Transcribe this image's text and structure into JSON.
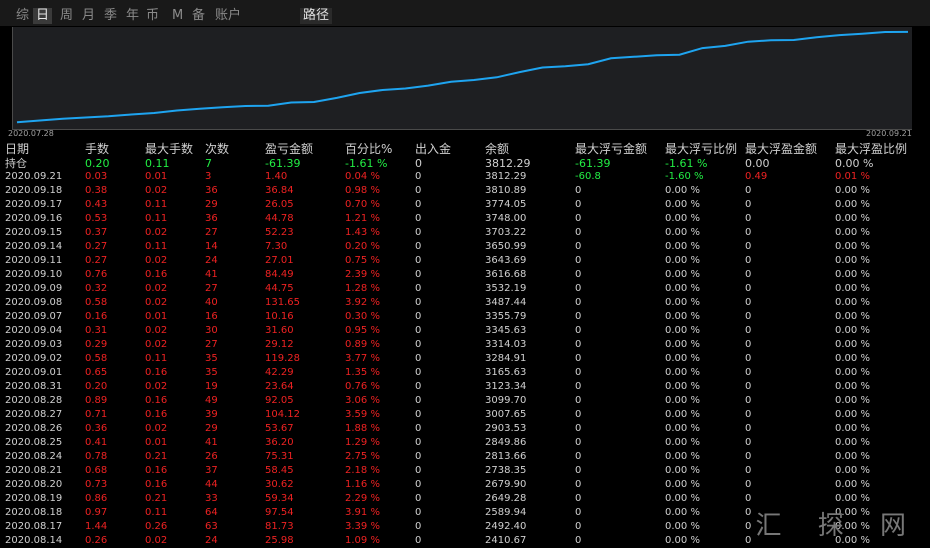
{
  "toolbar": {
    "tabs": [
      "综",
      "日",
      "周",
      "月",
      "季",
      "年",
      "币",
      "M",
      "备",
      "账户"
    ],
    "active_index": 1,
    "route_label": "路径"
  },
  "chart_data": {
    "type": "line",
    "x": [
      "2020.07.28",
      "2020.07.29",
      "2020.07.30",
      "2020.07.31",
      "2020.08.03",
      "2020.08.04",
      "2020.08.05",
      "2020.08.06",
      "2020.08.07",
      "2020.08.10",
      "2020.08.11",
      "2020.08.12",
      "2020.08.13",
      "2020.08.14",
      "2020.08.17",
      "2020.08.18",
      "2020.08.19",
      "2020.08.20",
      "2020.08.21",
      "2020.08.24",
      "2020.08.25",
      "2020.08.26",
      "2020.08.27",
      "2020.08.28",
      "2020.08.31",
      "2020.09.01",
      "2020.09.02",
      "2020.09.03",
      "2020.09.04",
      "2020.09.07",
      "2020.09.08",
      "2020.09.09",
      "2020.09.10",
      "2020.09.11",
      "2020.09.14",
      "2020.09.15",
      "2020.09.16",
      "2020.09.17",
      "2020.09.18",
      "2020.09.21"
    ],
    "values": [
      2005,
      2040,
      2075,
      2100,
      2125,
      2160,
      2190,
      2240,
      2275,
      2305,
      2330,
      2335,
      2400,
      2410.67,
      2492.4,
      2589.94,
      2649.28,
      2679.9,
      2738.35,
      2813.66,
      2849.86,
      2903.53,
      3007.65,
      3099.7,
      3123.34,
      3165.63,
      3284.91,
      3314.03,
      3345.63,
      3355.79,
      3487.44,
      3532.19,
      3616.68,
      3643.69,
      3650.99,
      3703.22,
      3748.0,
      3774.05,
      3810.89,
      3812.29
    ],
    "color": "#1ea4f0",
    "x_start_label": "2020.07.28",
    "x_end_label": "2020.09.21",
    "ylim": [
      1950,
      3830
    ]
  },
  "table": {
    "headers": [
      "日期",
      "手数",
      "最大手数",
      "次数",
      "盈亏金额",
      "百分比%",
      "出入金",
      "余额",
      "最大浮亏金额",
      "最大浮亏比例",
      "最大浮盈金额",
      "最大浮盈比例"
    ],
    "summary": [
      "持仓",
      "0.20",
      "0.11",
      "7",
      "-61.39",
      "-1.61 %",
      "0",
      "3812.29",
      "-61.39",
      "-1.61 %",
      "0.00",
      "0.00 %"
    ],
    "rows": [
      [
        "2020.09.21",
        "0.03",
        "0.01",
        "3",
        "1.40",
        "0.04 %",
        "0",
        "3812.29",
        "-60.8",
        "-1.60 %",
        "0.49",
        "0.01 %"
      ],
      [
        "2020.09.18",
        "0.38",
        "0.02",
        "36",
        "36.84",
        "0.98 %",
        "0",
        "3810.89",
        "0",
        "0.00 %",
        "0",
        "0.00 %"
      ],
      [
        "2020.09.17",
        "0.43",
        "0.11",
        "29",
        "26.05",
        "0.70 %",
        "0",
        "3774.05",
        "0",
        "0.00 %",
        "0",
        "0.00 %"
      ],
      [
        "2020.09.16",
        "0.53",
        "0.11",
        "36",
        "44.78",
        "1.21 %",
        "0",
        "3748.00",
        "0",
        "0.00 %",
        "0",
        "0.00 %"
      ],
      [
        "2020.09.15",
        "0.37",
        "0.02",
        "27",
        "52.23",
        "1.43 %",
        "0",
        "3703.22",
        "0",
        "0.00 %",
        "0",
        "0.00 %"
      ],
      [
        "2020.09.14",
        "0.27",
        "0.11",
        "14",
        "7.30",
        "0.20 %",
        "0",
        "3650.99",
        "0",
        "0.00 %",
        "0",
        "0.00 %"
      ],
      [
        "2020.09.11",
        "0.27",
        "0.02",
        "24",
        "27.01",
        "0.75 %",
        "0",
        "3643.69",
        "0",
        "0.00 %",
        "0",
        "0.00 %"
      ],
      [
        "2020.09.10",
        "0.76",
        "0.16",
        "41",
        "84.49",
        "2.39 %",
        "0",
        "3616.68",
        "0",
        "0.00 %",
        "0",
        "0.00 %"
      ],
      [
        "2020.09.09",
        "0.32",
        "0.02",
        "27",
        "44.75",
        "1.28 %",
        "0",
        "3532.19",
        "0",
        "0.00 %",
        "0",
        "0.00 %"
      ],
      [
        "2020.09.08",
        "0.58",
        "0.02",
        "40",
        "131.65",
        "3.92 %",
        "0",
        "3487.44",
        "0",
        "0.00 %",
        "0",
        "0.00 %"
      ],
      [
        "2020.09.07",
        "0.16",
        "0.01",
        "16",
        "10.16",
        "0.30 %",
        "0",
        "3355.79",
        "0",
        "0.00 %",
        "0",
        "0.00 %"
      ],
      [
        "2020.09.04",
        "0.31",
        "0.02",
        "30",
        "31.60",
        "0.95 %",
        "0",
        "3345.63",
        "0",
        "0.00 %",
        "0",
        "0.00 %"
      ],
      [
        "2020.09.03",
        "0.29",
        "0.02",
        "27",
        "29.12",
        "0.89 %",
        "0",
        "3314.03",
        "0",
        "0.00 %",
        "0",
        "0.00 %"
      ],
      [
        "2020.09.02",
        "0.58",
        "0.11",
        "35",
        "119.28",
        "3.77 %",
        "0",
        "3284.91",
        "0",
        "0.00 %",
        "0",
        "0.00 %"
      ],
      [
        "2020.09.01",
        "0.65",
        "0.16",
        "35",
        "42.29",
        "1.35 %",
        "0",
        "3165.63",
        "0",
        "0.00 %",
        "0",
        "0.00 %"
      ],
      [
        "2020.08.31",
        "0.20",
        "0.02",
        "19",
        "23.64",
        "0.76 %",
        "0",
        "3123.34",
        "0",
        "0.00 %",
        "0",
        "0.00 %"
      ],
      [
        "2020.08.28",
        "0.89",
        "0.16",
        "49",
        "92.05",
        "3.06 %",
        "0",
        "3099.70",
        "0",
        "0.00 %",
        "0",
        "0.00 %"
      ],
      [
        "2020.08.27",
        "0.71",
        "0.16",
        "39",
        "104.12",
        "3.59 %",
        "0",
        "3007.65",
        "0",
        "0.00 %",
        "0",
        "0.00 %"
      ],
      [
        "2020.08.26",
        "0.36",
        "0.02",
        "29",
        "53.67",
        "1.88 %",
        "0",
        "2903.53",
        "0",
        "0.00 %",
        "0",
        "0.00 %"
      ],
      [
        "2020.08.25",
        "0.41",
        "0.01",
        "41",
        "36.20",
        "1.29 %",
        "0",
        "2849.86",
        "0",
        "0.00 %",
        "0",
        "0.00 %"
      ],
      [
        "2020.08.24",
        "0.78",
        "0.21",
        "26",
        "75.31",
        "2.75 %",
        "0",
        "2813.66",
        "0",
        "0.00 %",
        "0",
        "0.00 %"
      ],
      [
        "2020.08.21",
        "0.68",
        "0.16",
        "37",
        "58.45",
        "2.18 %",
        "0",
        "2738.35",
        "0",
        "0.00 %",
        "0",
        "0.00 %"
      ],
      [
        "2020.08.20",
        "0.73",
        "0.16",
        "44",
        "30.62",
        "1.16 %",
        "0",
        "2679.90",
        "0",
        "0.00 %",
        "0",
        "0.00 %"
      ],
      [
        "2020.08.19",
        "0.86",
        "0.21",
        "33",
        "59.34",
        "2.29 %",
        "0",
        "2649.28",
        "0",
        "0.00 %",
        "0",
        "0.00 %"
      ],
      [
        "2020.08.18",
        "0.97",
        "0.11",
        "64",
        "97.54",
        "3.91 %",
        "0",
        "2589.94",
        "0",
        "0.00 %",
        "0",
        "0.00 %"
      ],
      [
        "2020.08.17",
        "1.44",
        "0.26",
        "63",
        "81.73",
        "3.39 %",
        "0",
        "2492.40",
        "0",
        "0.00 %",
        "0",
        "0.00 %"
      ],
      [
        "2020.08.14",
        "0.26",
        "0.02",
        "24",
        "25.98",
        "1.09 %",
        "0",
        "2410.67",
        "0",
        "0.00 %",
        "0",
        "0.00 %"
      ]
    ]
  },
  "watermark": "汇 探 网"
}
